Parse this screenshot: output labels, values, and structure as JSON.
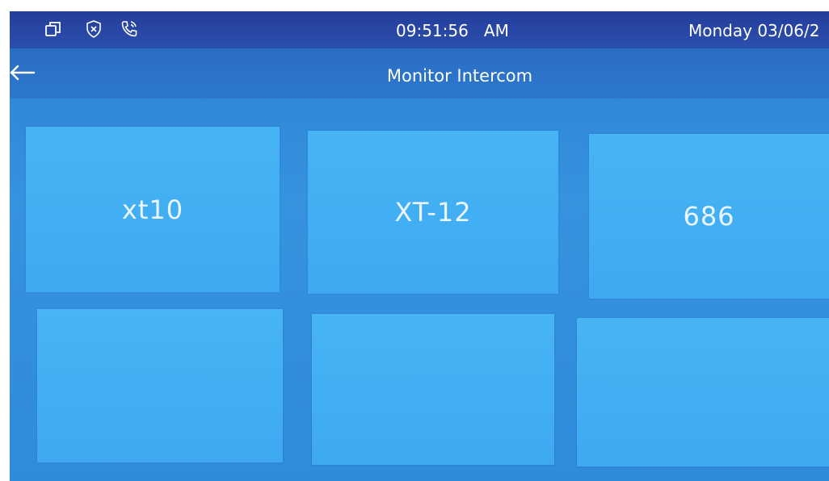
{
  "status_bar": {
    "time": "09:51:56",
    "meridiem": "AM",
    "date": "Monday 03/06/2",
    "icons": [
      "windows-icon",
      "shield-x-icon",
      "phone-icon"
    ]
  },
  "header": {
    "title": "Monitor Intercom",
    "back_icon": "left-arrow-icon"
  },
  "tiles": [
    {
      "label": "xt10"
    },
    {
      "label": "XT-12"
    },
    {
      "label": "686"
    },
    {
      "label": ""
    },
    {
      "label": ""
    },
    {
      "label": ""
    }
  ],
  "colors": {
    "status_bar": "#2c4fae",
    "title_bar": "#2d78cc",
    "background": "#3693e0",
    "tile": "#43aef3",
    "text": "#ffffff"
  }
}
